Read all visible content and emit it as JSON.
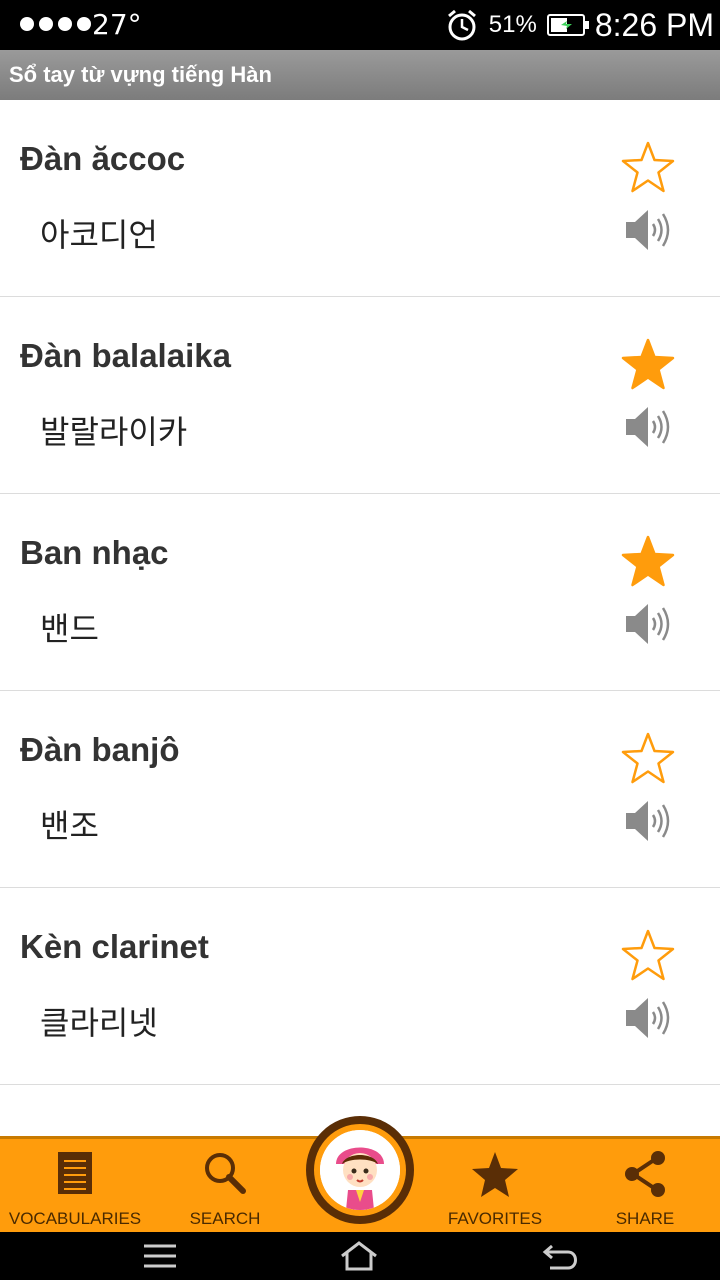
{
  "status": {
    "temperature": "27°",
    "battery": "51%",
    "time": "8:26 PM"
  },
  "app": {
    "title": "Sổ tay từ vựng tiếng Hàn"
  },
  "words": [
    {
      "vi": "Đàn ăccoc",
      "ko": "아코디언",
      "favorite": false
    },
    {
      "vi": "Đàn balalaika",
      "ko": "발랄라이카",
      "favorite": true
    },
    {
      "vi": "Ban nhạc",
      "ko": "밴드",
      "favorite": true
    },
    {
      "vi": "Đàn banjô",
      "ko": "밴조",
      "favorite": false
    },
    {
      "vi": "Kèn clarinet",
      "ko": "클라리넷",
      "favorite": false
    }
  ],
  "tabs": {
    "vocabularies": "VOCABULARIES",
    "search": "SEARCH",
    "favorites": "FAVORITES",
    "share": "SHARE"
  },
  "colors": {
    "accent": "#ff9c0c",
    "star": "#ff9c0c"
  }
}
